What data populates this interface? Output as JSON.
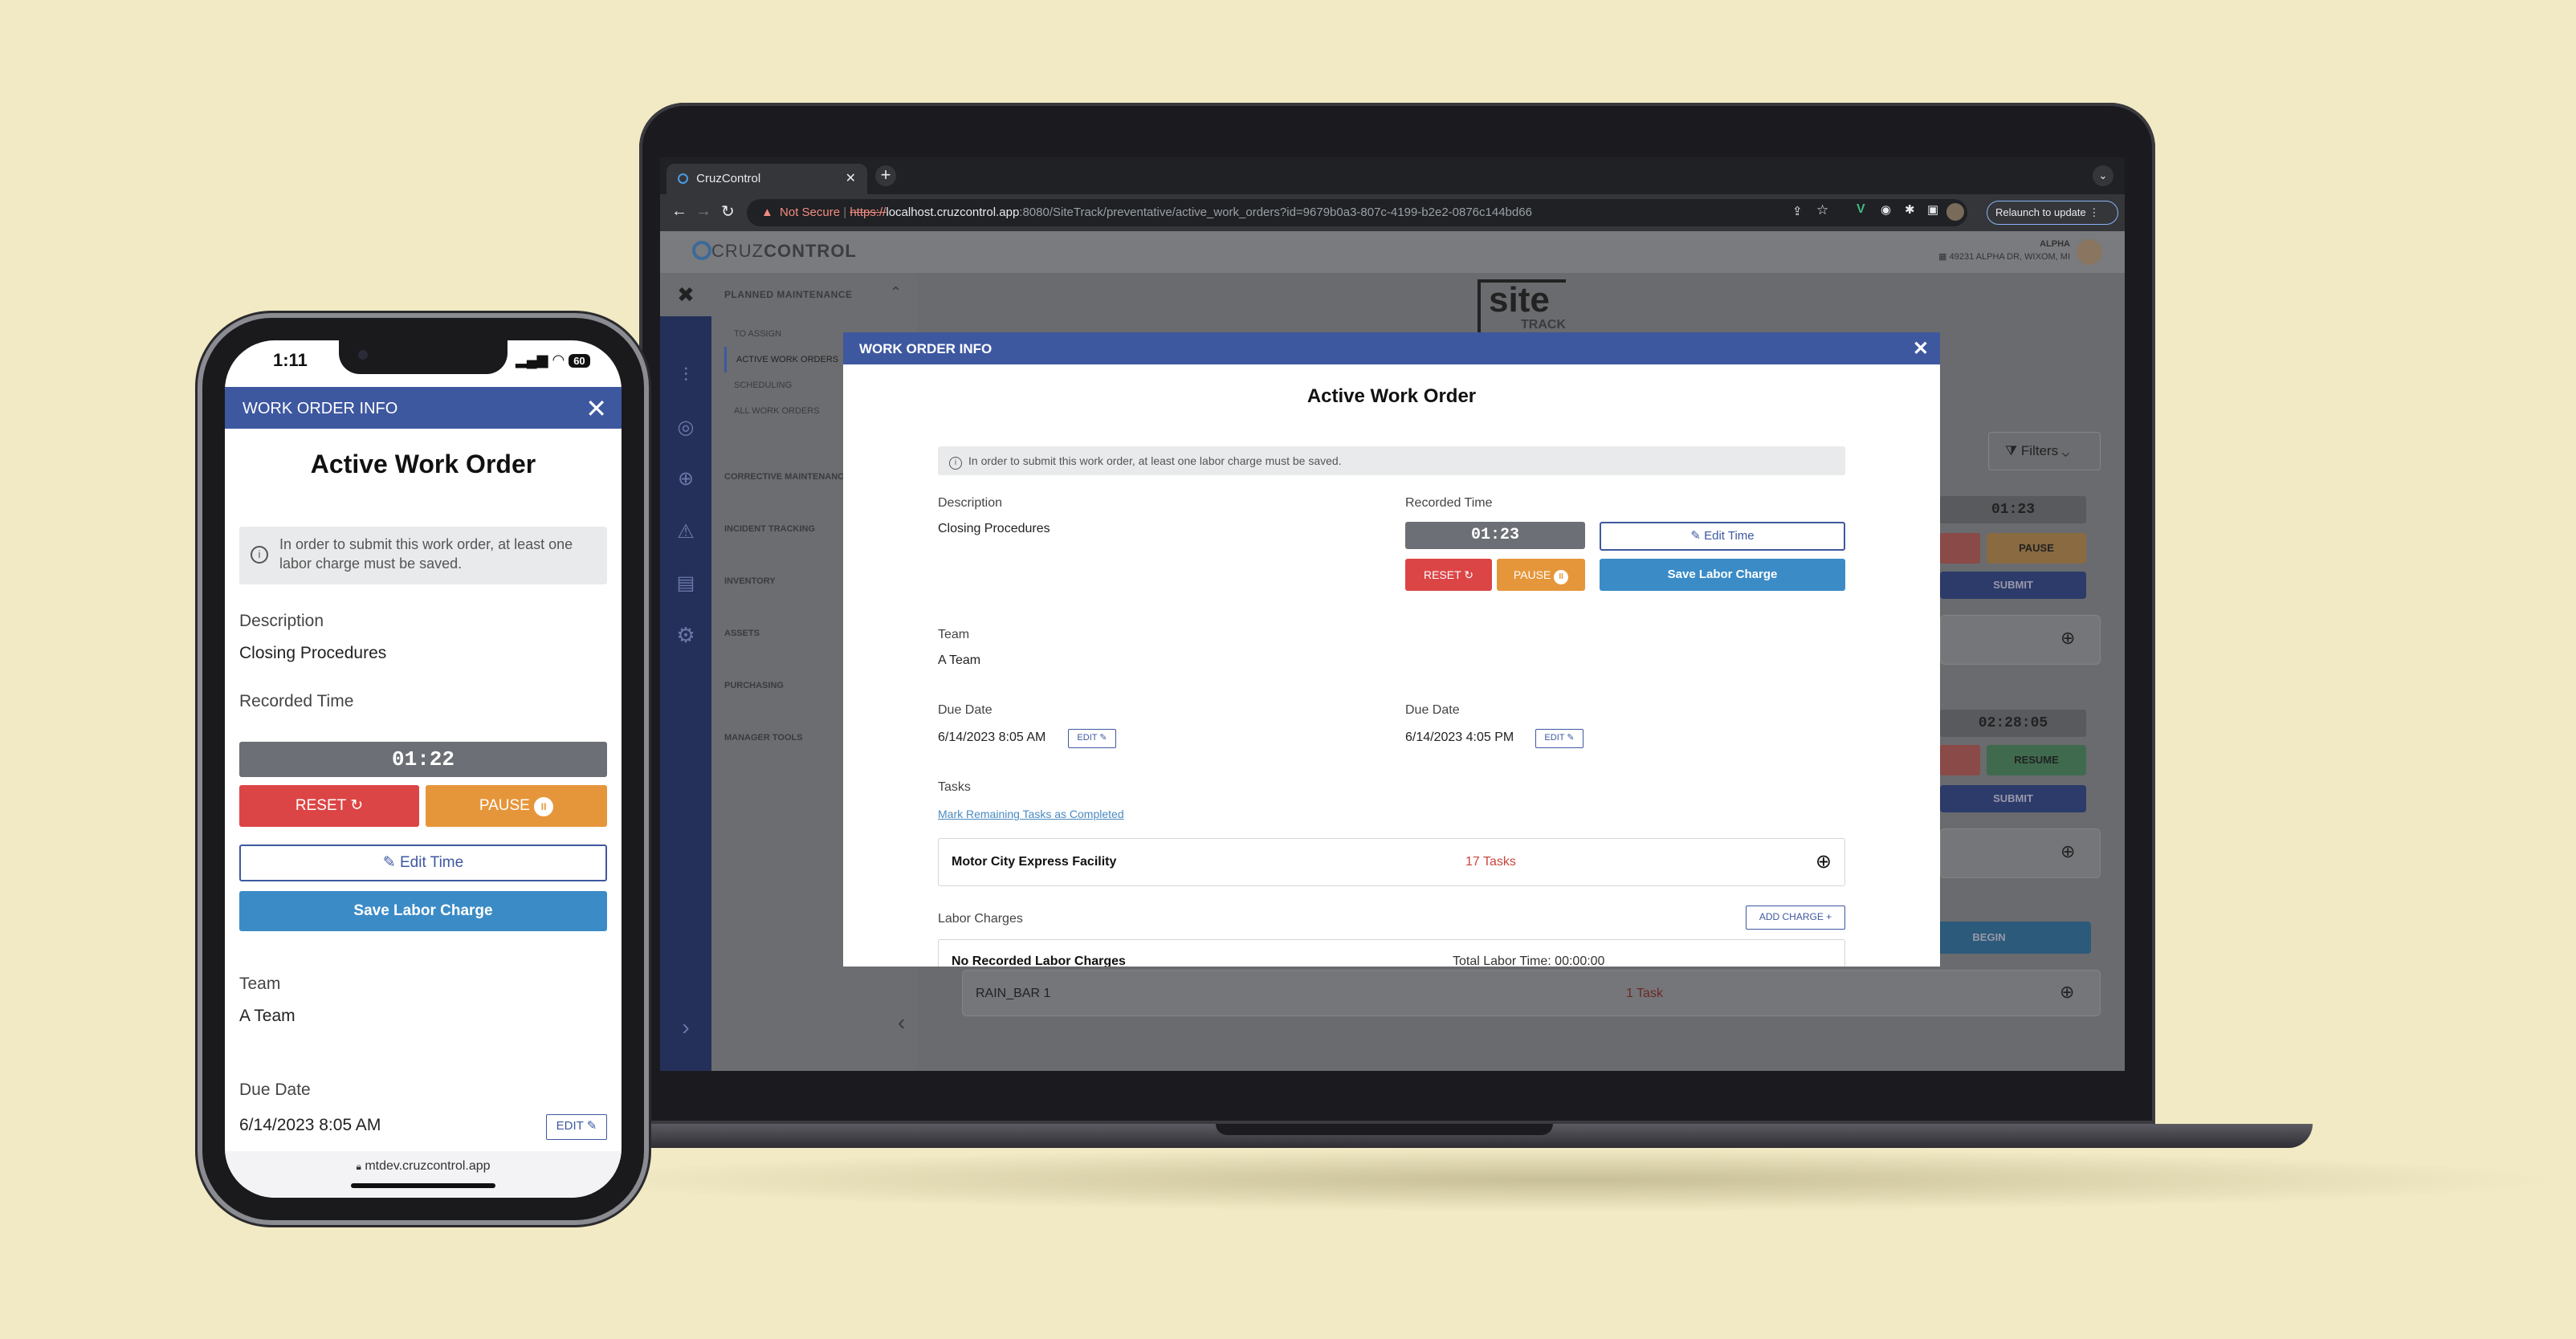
{
  "desktop": {
    "browser": {
      "tab_title": "CruzControl",
      "not_secure": "Not Secure",
      "url_scheme": "https://",
      "url_host": "localhost.cruzcontrol.app",
      "url_path": ":8080/SiteTrack/preventative/active_work_orders?id=9679b0a3-807c-4199-b2e2-0876c144bd66",
      "relaunch_label": "Relaunch to update"
    },
    "app": {
      "logo_prefix": "CRUZ",
      "logo_suffix": "CONTROL",
      "site_logo": "site",
      "site_logo_sub": "TRACK",
      "user_name": "ALPHA",
      "user_address": "49231 ALPHA DR, WIXOM, MI",
      "nav_section": "PLANNED MAINTENANCE",
      "nav_items": [
        "TO ASSIGN",
        "ACTIVE WORK ORDERS",
        "SCHEDULING",
        "ALL WORK ORDERS"
      ],
      "nav_groups": [
        "CORRECTIVE MAINTENANCE",
        "INCIDENT TRACKING",
        "INVENTORY",
        "ASSETS",
        "PURCHASING",
        "MANAGER TOOLS"
      ],
      "filters_label": "Filters",
      "bg_cards": {
        "timer1": "01:23",
        "pause_label": "PAUSE",
        "submit_label": "SUBMIT",
        "timer2": "02:28:05",
        "resume_label": "RESUME",
        "begin_label": "BEGIN",
        "rain_bar_name": "RAIN_BAR 1",
        "rain_bar_tasks": "1 Task"
      }
    },
    "modal": {
      "header": "WORK ORDER INFO",
      "title": "Active Work Order",
      "notice": "In order to submit this work order, at least one labor charge must be saved.",
      "description_label": "Description",
      "description_value": "Closing Procedures",
      "recorded_time_label": "Recorded Time",
      "timer": "01:23",
      "reset_label": "RESET",
      "pause_label": "PAUSE",
      "edit_time_label": "Edit Time",
      "save_labor_label": "Save Labor Charge",
      "team_label": "Team",
      "team_value": "A Team",
      "due_date_label_1": "Due Date",
      "due_date_value_1": "6/14/2023 8:05 AM",
      "due_date_label_2": "Due Date",
      "due_date_value_2": "6/14/2023 4:05 PM",
      "edit_label": "EDIT",
      "tasks_label": "Tasks",
      "mark_tasks_link": "Mark Remaining Tasks as Completed",
      "facility_name": "Motor City Express Facility",
      "facility_tasks": "17 Tasks",
      "labor_charges_label": "Labor Charges",
      "add_charge_label": "ADD CHARGE",
      "no_labor": "No Recorded Labor Charges",
      "total_labor": "Total Labor Time: 00:00:00"
    }
  },
  "phone": {
    "status_time": "1:11",
    "battery": "60",
    "header": "WORK ORDER INFO",
    "title": "Active Work Order",
    "notice": "In order to submit this work order, at least one labor charge must be saved.",
    "description_label": "Description",
    "description_value": "Closing Procedures",
    "recorded_time_label": "Recorded Time",
    "timer": "01:22",
    "reset_label": "RESET",
    "pause_label": "PAUSE",
    "edit_time_label": "Edit Time",
    "save_labor_label": "Save Labor Charge",
    "team_label": "Team",
    "team_value": "A Team",
    "due_date_label": "Due Date",
    "due_date_value": "6/14/2023 8:05 AM",
    "edit_label": "EDIT",
    "url": "mtdev.cruzcontrol.app"
  },
  "colors": {
    "background": "#f2eac4",
    "brand_blue": "#3e58a0",
    "reset_red": "#dc4545",
    "pause_orange": "#e6963a",
    "save_blue": "#3b8bc6",
    "tasks_red": "#c8453d"
  }
}
